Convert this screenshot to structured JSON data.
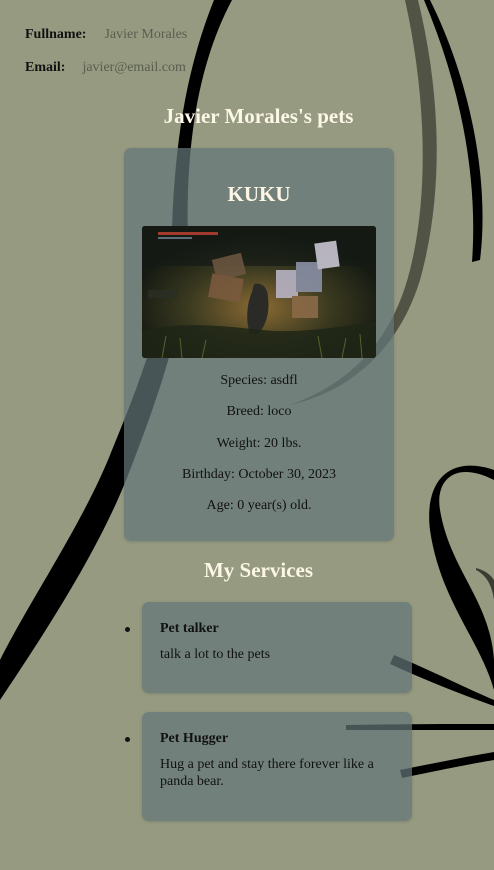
{
  "profile": {
    "fullname_label": "Fullname:",
    "fullname_value": "Javier Morales",
    "email_label": "Email:",
    "email_value": "javier@email.com"
  },
  "pets_heading": "Javier Morales's pets",
  "pet": {
    "name": "KUKU",
    "photo": "pet-photo",
    "species": "Species: asdfl",
    "breed": "Breed: loco",
    "weight": "Weight: 20 lbs.",
    "birthday": "Birthday: October 30, 2023",
    "age": "Age: 0 year(s) old."
  },
  "services_heading": "My Services",
  "services": [
    {
      "title": "Pet talker",
      "description": "talk a lot to the pets"
    },
    {
      "title": "Pet Hugger",
      "description": "Hug a pet and stay there forever like a panda bear."
    }
  ],
  "colors": {
    "background": "#959a80",
    "card": "#647678",
    "heading": "#fcf7e6"
  }
}
